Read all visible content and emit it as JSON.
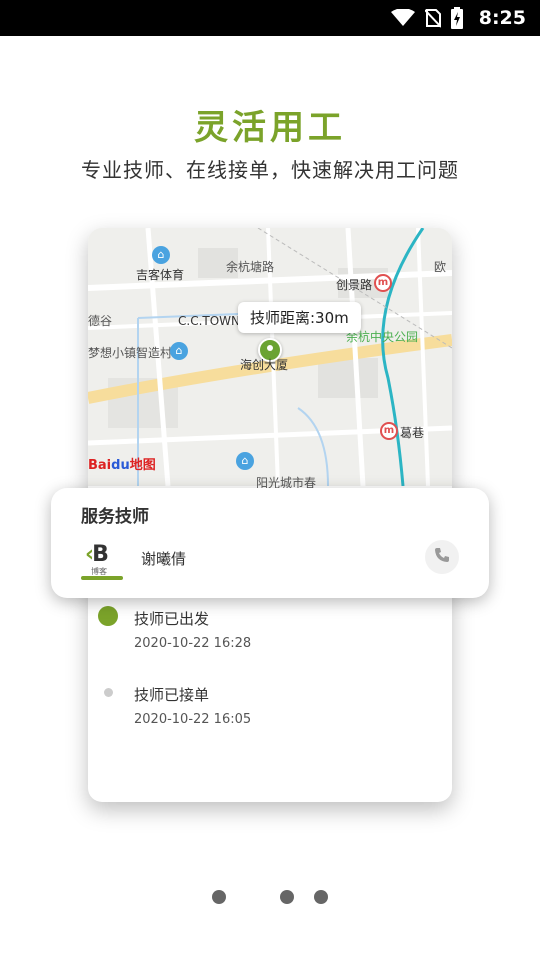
{
  "status_bar": {
    "time": "8:25",
    "icons": [
      "wifi-icon",
      "no-sim-icon",
      "battery-charging-icon"
    ]
  },
  "hero": {
    "title": "灵活用工",
    "subtitle": "专业技师、在线接单，快速解决用工问题"
  },
  "map": {
    "distance_label": "技师距离:30m",
    "labels": {
      "gym": "吉客体育",
      "road1": "余杭塘路",
      "road2": "创景路",
      "area_left": "德谷",
      "cctown": "C.C.TOWN",
      "village": "梦想小镇智造村",
      "park": "余杭中央公园",
      "building": "海创大厦",
      "metro": "葛巷",
      "top_right": "欧",
      "bottom": "阳光城市春"
    },
    "provider_logo": {
      "red": "Bai",
      "blue": "du",
      "suffix": "地图"
    }
  },
  "service_card": {
    "title": "服务技师",
    "brand_logo": {
      "mark": "B",
      "caption": "博客"
    },
    "technician_name": "谢曦倩"
  },
  "timeline": [
    {
      "status": "技师已出发",
      "time": "2020-10-22 16:28"
    },
    {
      "status": "技师已接单",
      "time": "2020-10-22 16:05"
    }
  ],
  "pager": {
    "total": 3,
    "current": 0
  },
  "colors": {
    "accent": "#7ba32a",
    "status_bar": "#000000"
  }
}
